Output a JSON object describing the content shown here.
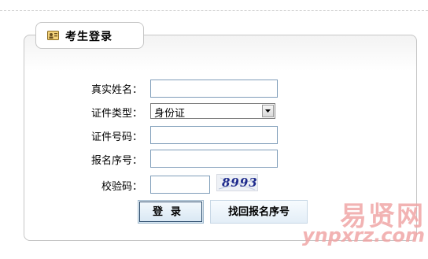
{
  "header": {
    "title": "考生登录",
    "icon": "id-card-icon"
  },
  "form": {
    "name_label": "真实姓名：",
    "name_value": "",
    "id_type_label": "证件类型：",
    "id_type_value": "身份证",
    "id_number_label": "证件号码：",
    "id_number_value": "",
    "reg_number_label": "报名序号：",
    "reg_number_value": "",
    "captcha_label": "校验码：",
    "captcha_value": "",
    "captcha_image_text": "8993"
  },
  "buttons": {
    "login": "登录",
    "find_reg_number": "找回报名序号"
  },
  "watermark": {
    "cn": "易贤网",
    "en": "ynpxrz.com"
  },
  "colors": {
    "input_border": "#7f9db9",
    "panel_border": "#c6c6c6",
    "watermark": "#f0a6a6"
  }
}
